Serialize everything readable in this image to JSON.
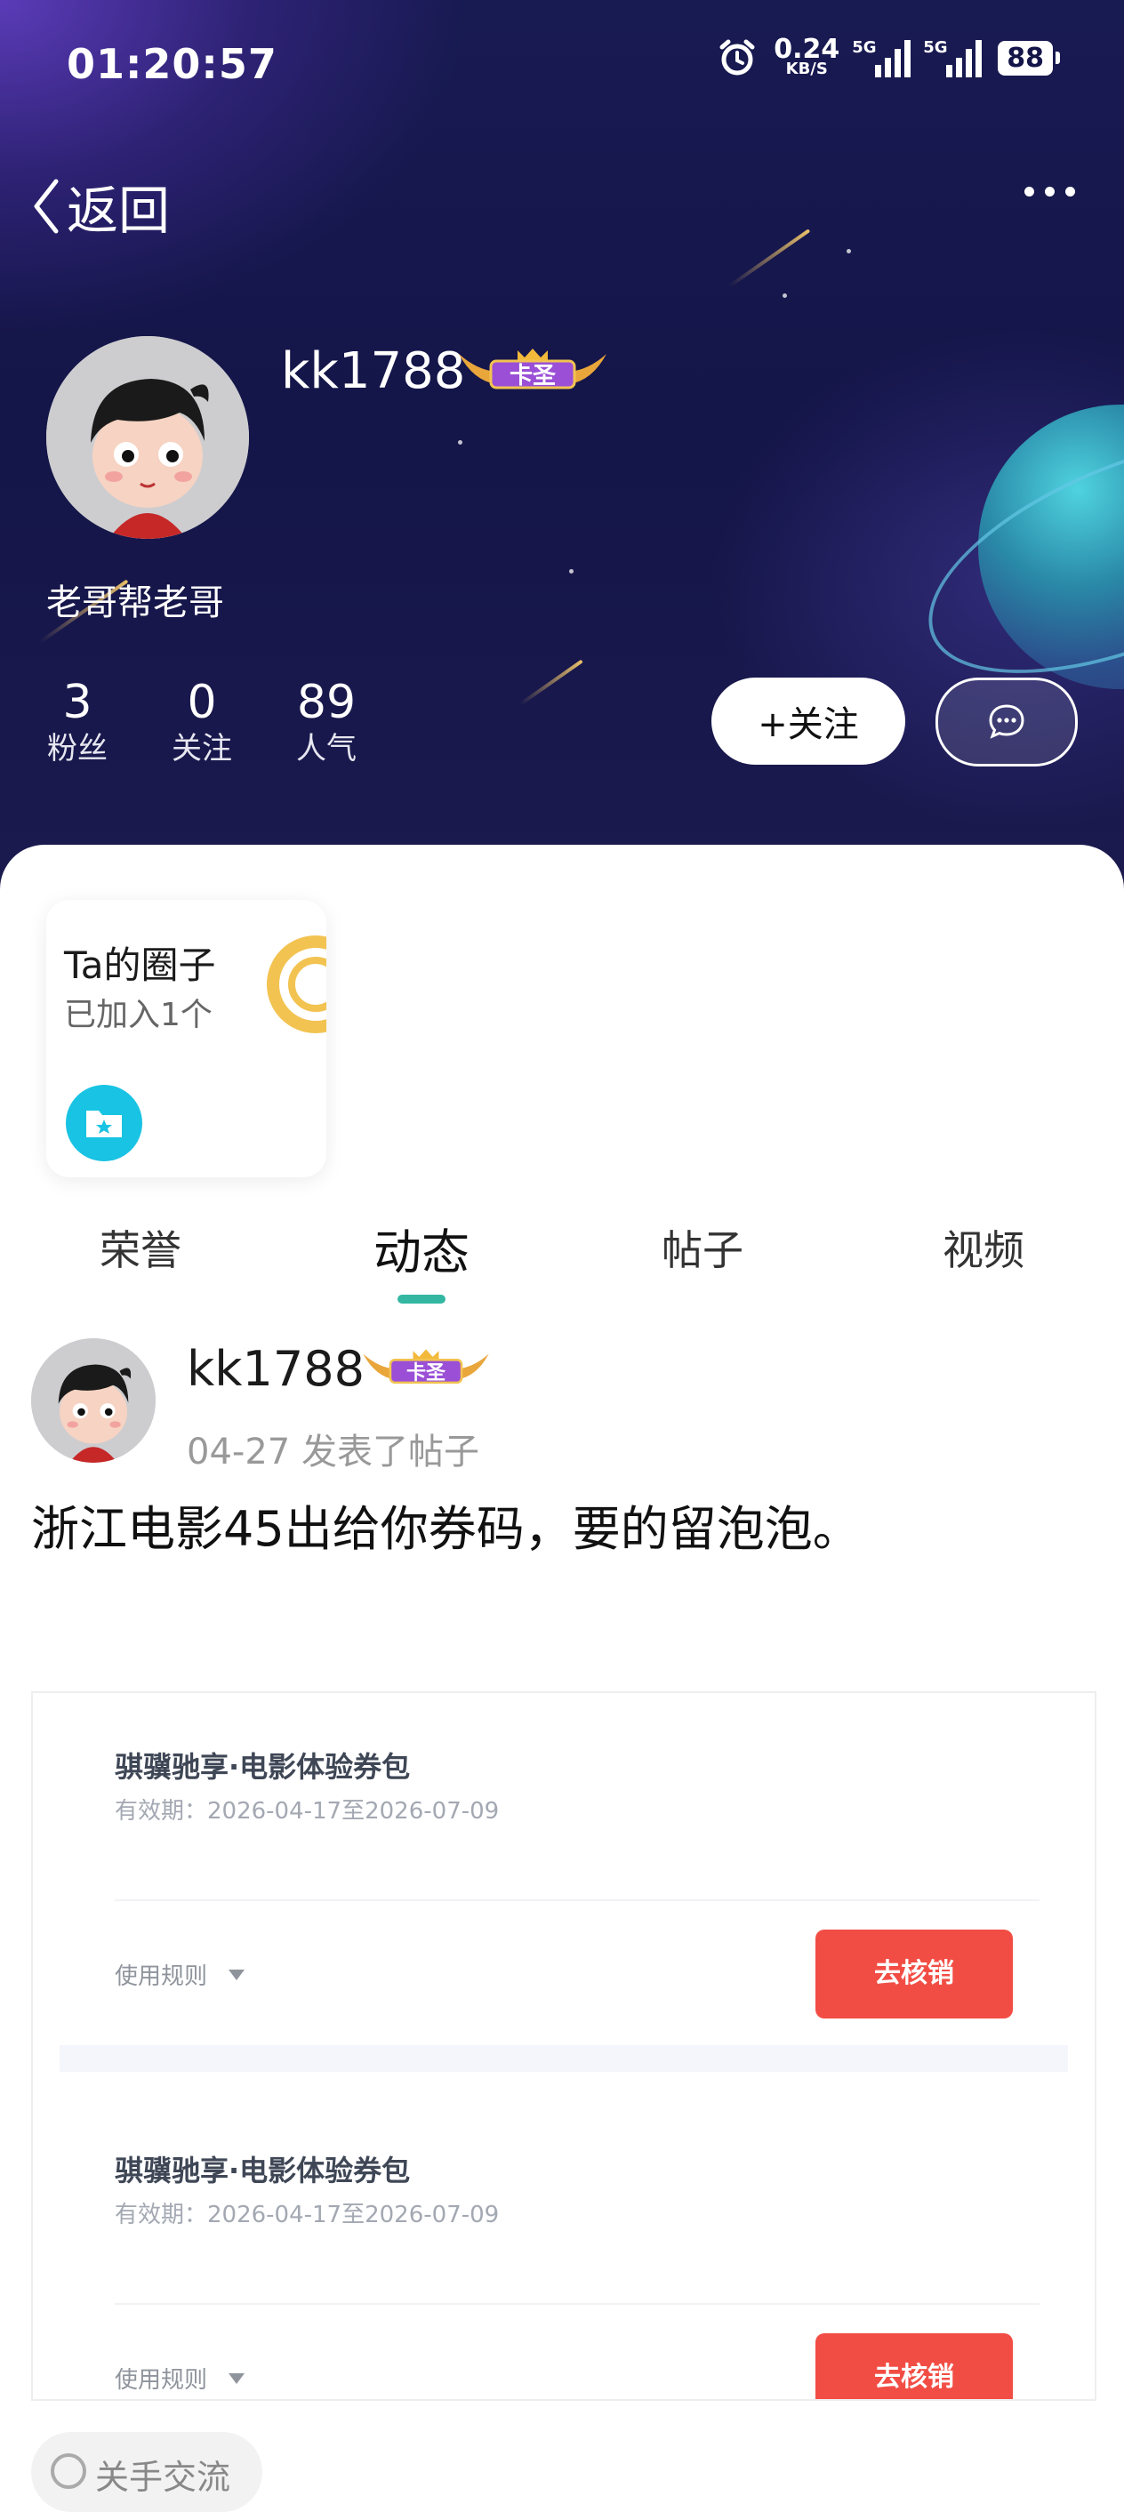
{
  "status_bar": {
    "time": "01:20:57",
    "net_speed": "0.24",
    "net_unit": "KB/S",
    "signal1": "5G",
    "signal2": "5G",
    "battery": "88"
  },
  "nav": {
    "back_label": "返回"
  },
  "profile": {
    "username": "kk1788",
    "badge_text": "卡圣",
    "bio": "老哥帮老哥",
    "stats": [
      {
        "value": "3",
        "label": "粉丝"
      },
      {
        "value": "0",
        "label": "关注"
      },
      {
        "value": "89",
        "label": "人气"
      }
    ],
    "follow_label": "+关注"
  },
  "circle_card": {
    "title": "Ta的圈子",
    "subtitle": "已加入1个"
  },
  "tabs": [
    "荣誉",
    "动态",
    "帖子",
    "视频"
  ],
  "active_tab": "动态",
  "post": {
    "author": "kk1788",
    "badge_text": "卡圣",
    "meta": "04-27 发表了帖子",
    "text": "浙江电影45出给你券码，要的留泡泡。",
    "coupons": [
      {
        "title": "骐骥驰享·电影体验券包",
        "validity": "有效期：2026-04-17至2026-07-09",
        "rule": "使用规则",
        "button": "去核销"
      },
      {
        "title": "骐骥驰享·电影体验券包",
        "validity": "有效期：2026-04-17至2026-07-09",
        "rule": "使用规则",
        "button": "去核销"
      }
    ]
  },
  "chip": {
    "label": "关手交流"
  },
  "colors": {
    "accent": "#33b7a3",
    "hero_bg": "#141548",
    "coupon_button": "#f24d44",
    "circle_icon": "#19c3e3"
  }
}
